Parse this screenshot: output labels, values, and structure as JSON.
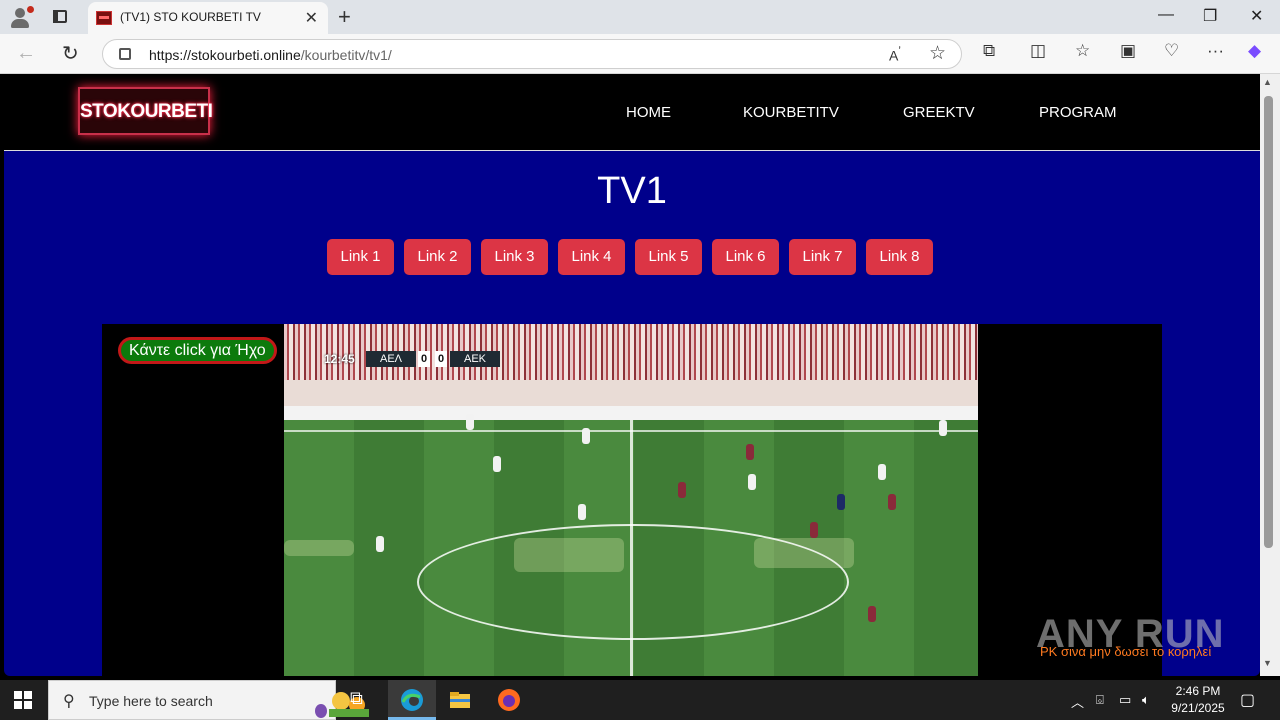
{
  "browser": {
    "tab_title": "(TV1) STO KOURBETI TV",
    "tab_close": "✕",
    "new_tab": "+",
    "url_host": "https://stokourbeti.online",
    "url_path": "/kourbetitv/tv1/",
    "window_controls": {
      "minimize": "—",
      "restore": "❐",
      "close": "✕"
    }
  },
  "site": {
    "logo_text": "STOKOURBETI",
    "menu": [
      "HOME",
      "KOURBETITV",
      "GREEKTV",
      "PROGRAM"
    ],
    "page_title": "TV1",
    "links": [
      "Link 1",
      "Link 2",
      "Link 3",
      "Link 4",
      "Link 5",
      "Link 6",
      "Link 7",
      "Link 8"
    ],
    "link_color": "#dc3545",
    "background_color": "#00008b"
  },
  "player": {
    "sound_button": "Κάντε click για Ήχο",
    "scoreboard": {
      "time": "12:45",
      "home": "ΑΕΛ",
      "home_score": "0",
      "away_score": "0",
      "away": "ΑΕΚ"
    },
    "ticker": "ΡΚ σινα μην δωσει το κορηλεί"
  },
  "watermark": "ANY RUN",
  "taskbar": {
    "search_placeholder": "Type here to search",
    "time": "2:46 PM",
    "date": "9/21/2025"
  }
}
